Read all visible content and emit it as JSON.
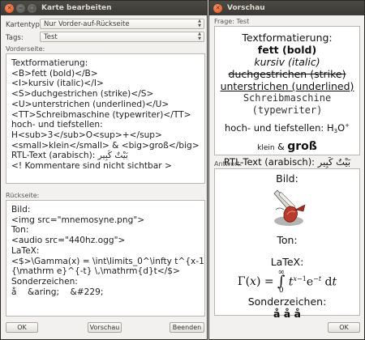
{
  "editor": {
    "title": "Karte bearbeiten",
    "cardtype_label": "Kartentyp:",
    "cardtype_value": "Nur Vorder-auf-Rückseite",
    "tags_label": "Tags:",
    "tags_value": "Test",
    "front_label": "Vorderseite:",
    "front_text": "Textformatierung:\n<B>fett (bold)</B>\n<I>kursiv (italic)</I>\n<S>duchgestrichen (strike)</S>\n<U>unterstrichen (underlined)</U>\n<TT>Schreibmaschine (typewriter)</TT>\nhoch- und tiefstellen:\nH<sub>3</sub>O<sup>+</sup>\n<small>klein</small> & <big>groß</big>\nRTL-Text (arabisch): بَيْتٌ كَبِير\n<! Kommentare sind nicht sichtbar >",
    "back_label": "Rückseite:",
    "back_text": "Bild:\n<img src=\"mnemosyne.png\">\nTon:\n<audio src=\"440hz.ogg\">\nLaTeX:\n<$>\\Gamma(x) = \\int\\limits_0^\\infty t^{x-1}\n{\\mathrm e}^{-t} \\,\\mathrm{d}t</$>\nSonderzeichen:\nå    &aring;    &#229;",
    "ok_label": "OK",
    "preview_label": "Vorschau",
    "quit_label": "Beenden"
  },
  "preview": {
    "title": "Vorschau",
    "question_label": "Frage: Test",
    "q": {
      "heading": "Textformatierung:",
      "bold": "fett (bold)",
      "italic": "kursiv (italic)",
      "strike": "duchgestrichen (strike)",
      "underline": "unterstrichen (underlined)",
      "mono_1": "Schreibmaschine",
      "mono_2": "(typewriter)",
      "subsup_text": "hoch- und tiefstellen: H",
      "sub": "3",
      "o": "O",
      "sup": "+",
      "small": "klein",
      "amp": " & ",
      "big": "groß",
      "rtl": "RTL-Text (arabisch): بَيْتٌ كَبِير"
    },
    "answer_label": "Antwort:",
    "a": {
      "bild": "Bild:",
      "ton": "Ton:",
      "latex": "LaTeX:",
      "sonder": "Sonderzeichen:",
      "chars": "å å å"
    },
    "ok_label": "OK"
  },
  "colors": {
    "title_bg": "#3c3b37",
    "close": "#df4a15",
    "window_bg": "#f2f1ef"
  }
}
